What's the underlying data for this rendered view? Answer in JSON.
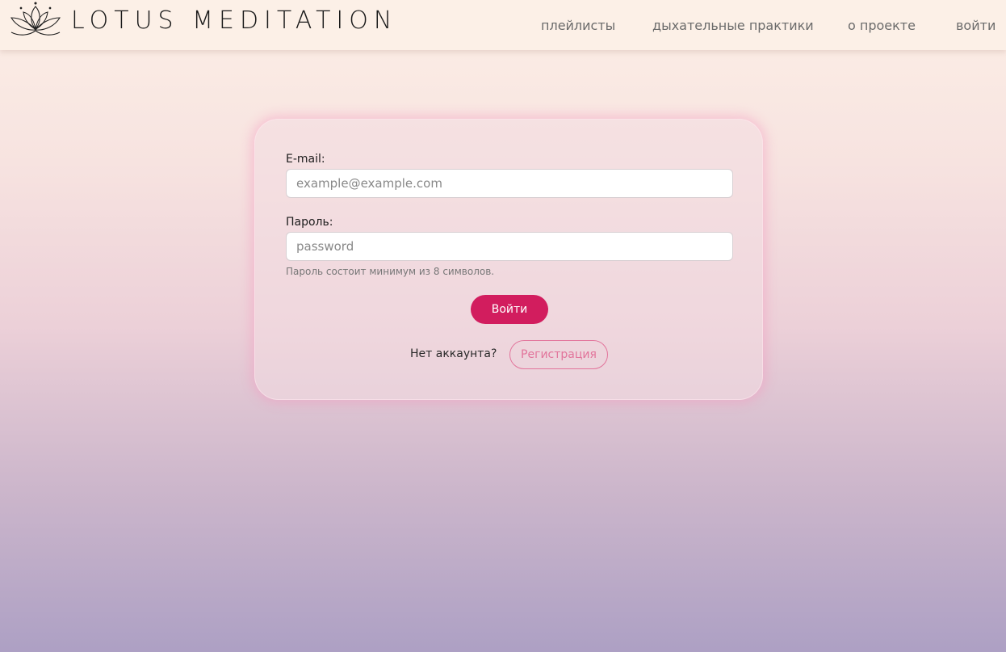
{
  "header": {
    "logo_text": "LOTUS MEDITATION",
    "nav": [
      {
        "label": "плейлисты"
      },
      {
        "label": "дыхательные практики"
      },
      {
        "label": "о проекте"
      },
      {
        "label": "войти"
      }
    ]
  },
  "login_form": {
    "email_label": "E-mail:",
    "email_placeholder": "example@example.com",
    "password_label": "Пароль:",
    "password_placeholder": "password",
    "password_hint": "Пароль состоит минимум из 8 символов.",
    "submit_label": "Войти",
    "no_account_text": "Нет аккаунта?",
    "register_label": "Регистрация"
  },
  "colors": {
    "accent": "#d21d5e",
    "register_outline": "#e2749b",
    "header_bg": "#fcf0e7"
  },
  "icons": {
    "logo": "lotus-icon"
  }
}
